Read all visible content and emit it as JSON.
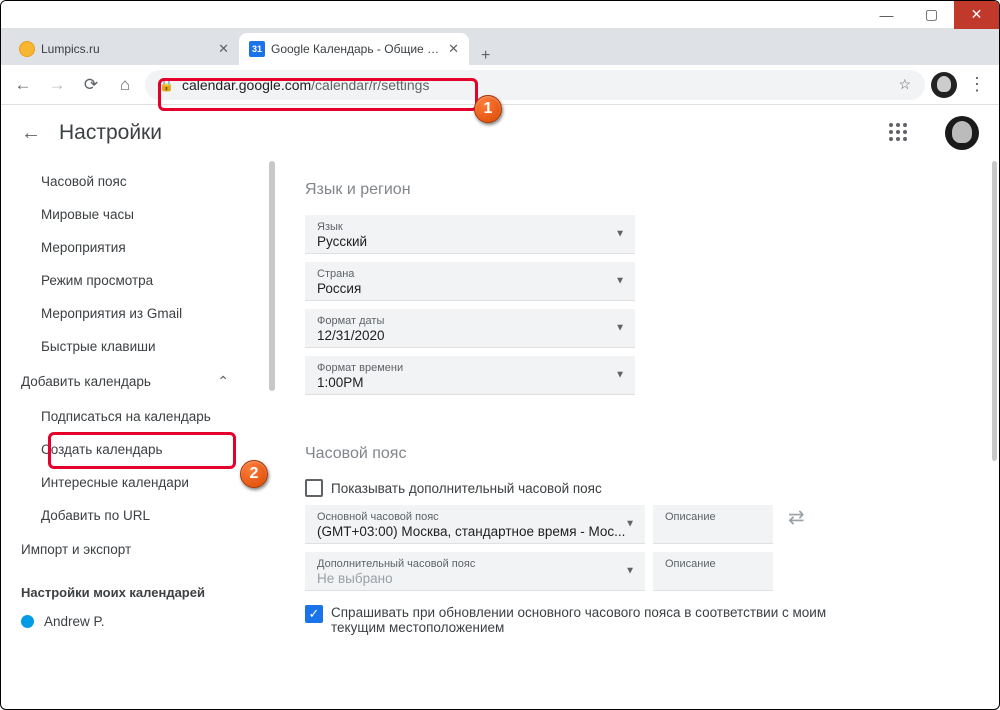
{
  "window": {
    "controls": {
      "min": "—",
      "max": "▢",
      "close": "✕"
    }
  },
  "tabs": [
    {
      "favicon": "lumpics",
      "title": "Lumpics.ru",
      "active": false
    },
    {
      "favicon": "gcal",
      "favicon_text": "31",
      "title": "Google Календарь - Общие нас",
      "active": true
    }
  ],
  "toolbar": {
    "url_domain": "calendar.google.com",
    "url_path": "/calendar/r/settings"
  },
  "app": {
    "title": "Настройки"
  },
  "sidebar": {
    "items": [
      "Часовой пояс",
      "Мировые часы",
      "Мероприятия",
      "Режим просмотра",
      "Мероприятия из Gmail",
      "Быстрые клавиши"
    ],
    "add_section": "Добавить календарь",
    "add_items": [
      "Подписаться на календарь",
      "Создать календарь",
      "Интересные календари",
      "Добавить по URL"
    ],
    "import_export": "Импорт и экспорт",
    "my_cals_heading": "Настройки моих календарей",
    "calendars": [
      {
        "name": "Andrew P.",
        "color": "#039be5"
      }
    ]
  },
  "settings": {
    "lang_section": "Язык и регион",
    "fields": {
      "lang_label": "Язык",
      "lang_value": "Русский",
      "country_label": "Страна",
      "country_value": "Россия",
      "date_label": "Формат даты",
      "date_value": "12/31/2020",
      "time_label": "Формат времени",
      "time_value": "1:00PM"
    },
    "tz_section": "Часовой пояс",
    "tz_show_secondary": "Показывать дополнительный часовой пояс",
    "tz_primary_label": "Основной часовой пояс",
    "tz_primary_value": "(GMT+03:00) Москва, стандартное время - Мос...",
    "tz_desc": "Описание",
    "tz_secondary_label": "Дополнительный часовой пояс",
    "tz_secondary_value": "Не выбрано",
    "tz_ask": "Спрашивать при обновлении основного часового пояса в соответствии с моим текущим местоположением"
  },
  "annotations": {
    "b1": "1",
    "b2": "2"
  }
}
